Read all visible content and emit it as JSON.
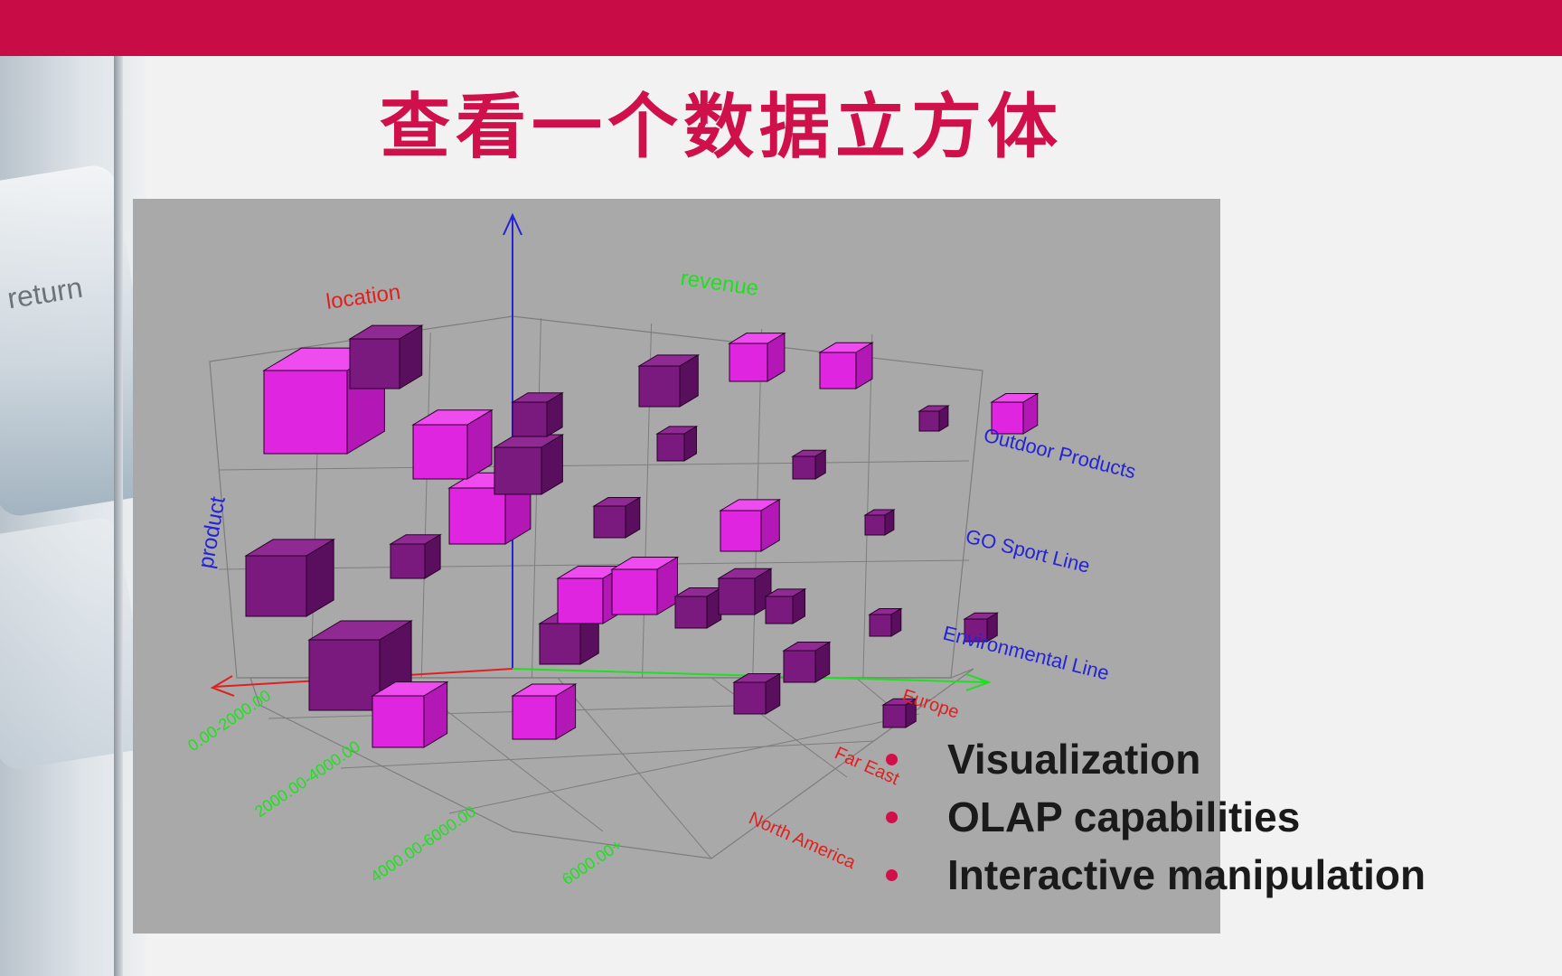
{
  "slide": {
    "title": "查看一个数据立方体",
    "side_label": "return",
    "colors": {
      "topbar": "#c80d46",
      "title": "#d0104a",
      "chart_background": "#a9a9a9",
      "cube_light": "#d11fd1",
      "cube_dark": "#6e1470",
      "product_axis": "#2323d8",
      "location_axis": "#e02020",
      "revenue_axis": "#1ee01e"
    }
  },
  "bullets": [
    "Visualization",
    "OLAP capabilities",
    "Interactive manipulation"
  ],
  "chart_data": {
    "type": "3d-bar",
    "axes": {
      "product_label": "product",
      "location_label": "location",
      "revenue_label": "revenue"
    },
    "products": [
      "Outdoor Products",
      "GO Sport Line",
      "Environmental Line"
    ],
    "locations": [
      "Europe",
      "Far East",
      "North America"
    ],
    "revenue_ranges": [
      "0.00-2000.00",
      "2000.00-4000.00",
      "4000.00-6000.00",
      "6000.00+"
    ]
  }
}
